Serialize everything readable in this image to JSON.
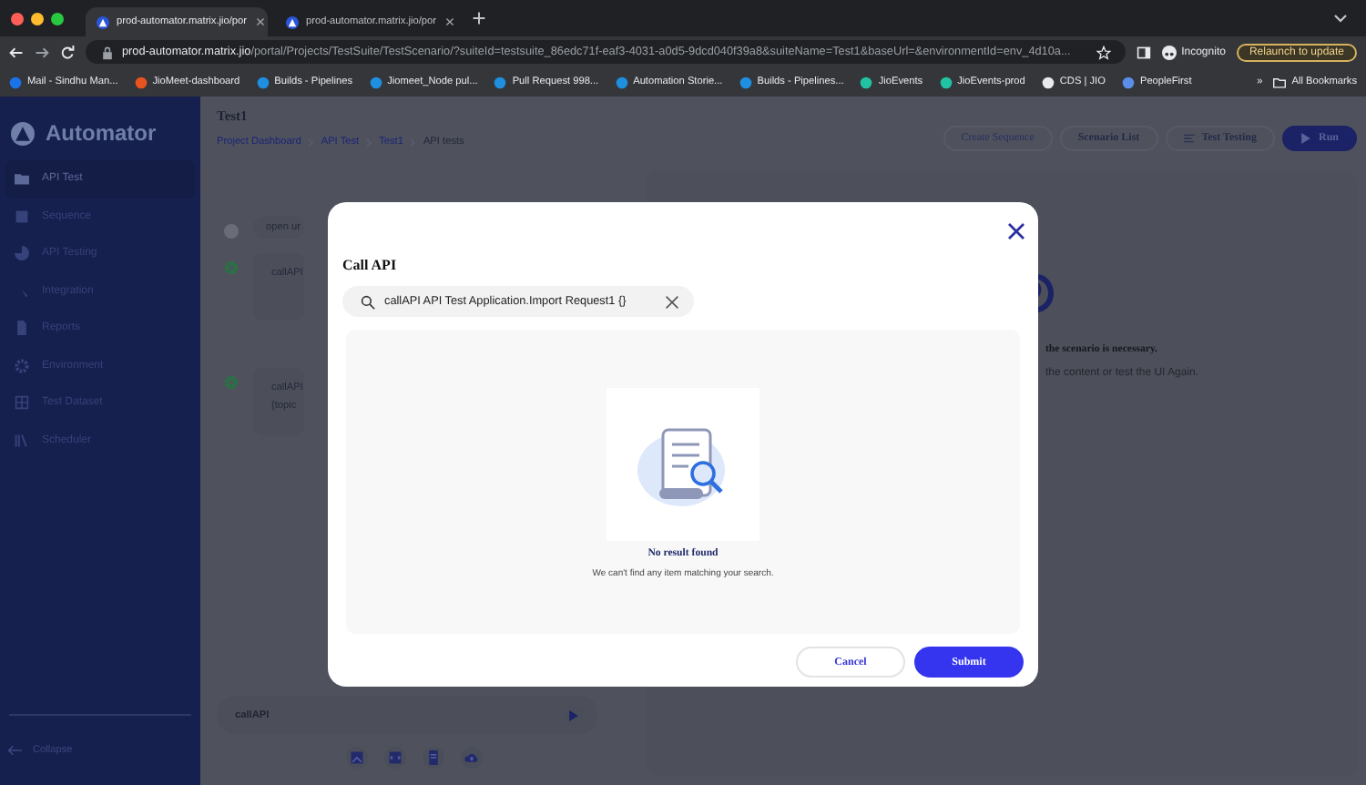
{
  "browser": {
    "tabs": [
      {
        "title": "prod-automator.matrix.jio/por",
        "selected": true
      },
      {
        "title": "prod-automator.matrix.jio/por",
        "selected": false
      }
    ],
    "url_host": "prod-automator.matrix.jio",
    "url_path": "/portal/Projects/TestSuite/TestScenario/?suiteId=testsuite_86edc71f-eaf3-4031-a0d5-9dcd040f39a8&suiteName=Test1&baseUrl=&environmentId=env_4d10a...",
    "profile": "Incognito",
    "update_button": "Relaunch to update",
    "bookmarks": [
      {
        "label": "Mail - Sindhu Man..."
      },
      {
        "label": "JioMeet-dashboard"
      },
      {
        "label": "Builds - Pipelines"
      },
      {
        "label": "Jiomeet_Node pul..."
      },
      {
        "label": "Pull Request 998..."
      },
      {
        "label": "Automation Storie..."
      },
      {
        "label": "Builds - Pipelines..."
      },
      {
        "label": "JioEvents"
      },
      {
        "label": "JioEvents-prod"
      },
      {
        "label": "CDS | JIO"
      },
      {
        "label": "PeopleFirst"
      }
    ],
    "more_bookmarks": "»",
    "all_bookmarks": "All Bookmarks"
  },
  "sidebar": {
    "logo": "Automator",
    "items": [
      {
        "label": "API Test",
        "selected": true
      },
      {
        "label": "Sequence",
        "selected": false
      },
      {
        "label": "API Testing",
        "selected": false
      },
      {
        "label": "Integration",
        "selected": false
      },
      {
        "label": "Reports",
        "selected": false
      },
      {
        "label": "Environment",
        "selected": false
      },
      {
        "label": "Test Dataset",
        "selected": false
      },
      {
        "label": "Scheduler",
        "selected": false
      }
    ],
    "collapse": "Collapse"
  },
  "header": {
    "title": "Test1",
    "breadcrumbs": [
      "Project Dashboard",
      "API Test",
      "Test1",
      "API tests"
    ],
    "actions": [
      {
        "label": "Create Sequence",
        "kind": "faint"
      },
      {
        "label": "Scenario List",
        "kind": "outline"
      },
      {
        "label": "Test Testing",
        "kind": "menu"
      },
      {
        "label": "Run",
        "kind": "primary"
      }
    ]
  },
  "steps": [
    {
      "kind": "info",
      "lines": [
        "open ur"
      ]
    },
    {
      "kind": "gear",
      "lines": [
        "callAPI"
      ]
    },
    {
      "kind": "gear",
      "lines": [
        "callAPI",
        "{topic"
      ]
    }
  ],
  "message": {
    "title": "the scenario is necessary.",
    "hint": "the content or test the UI Again."
  },
  "command": {
    "value": "callAPI"
  },
  "modal": {
    "title": "Call API",
    "search": {
      "value": "callAPI API Test Application.Import Request1 {}"
    },
    "empty_title": "No result found",
    "empty_text": "We can't find any item matching your search.",
    "buttons": [
      {
        "label": "Cancel",
        "kind": "secondary"
      },
      {
        "label": "Submit",
        "kind": "primary"
      }
    ]
  }
}
